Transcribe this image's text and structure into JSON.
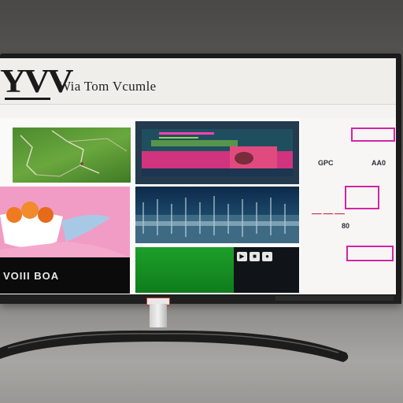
{
  "header": {
    "logo_text": "YVV",
    "site_title": "Wia Tom Vcumle"
  },
  "tiles": {
    "bowl_caption": "VOIII BOA",
    "player_controls": [
      "▶",
      "■",
      "●"
    ]
  },
  "sidebar": {
    "badge_top": "",
    "label_1": "GPC",
    "label_2": "AA0",
    "badge_mid": "",
    "label_3": "80",
    "label_4": "",
    "badge_bottom": "",
    "small_line_1": "",
    "small_line_2": "",
    "small_line_3": ""
  },
  "stand": {
    "label": ""
  },
  "colors": {
    "accent_magenta": "#d324a8",
    "screen_bg": "#f4f3f1",
    "bezel": "#1b1b1c",
    "field_green": "#1d9f2a",
    "pink_tile": "#f19cc4"
  }
}
